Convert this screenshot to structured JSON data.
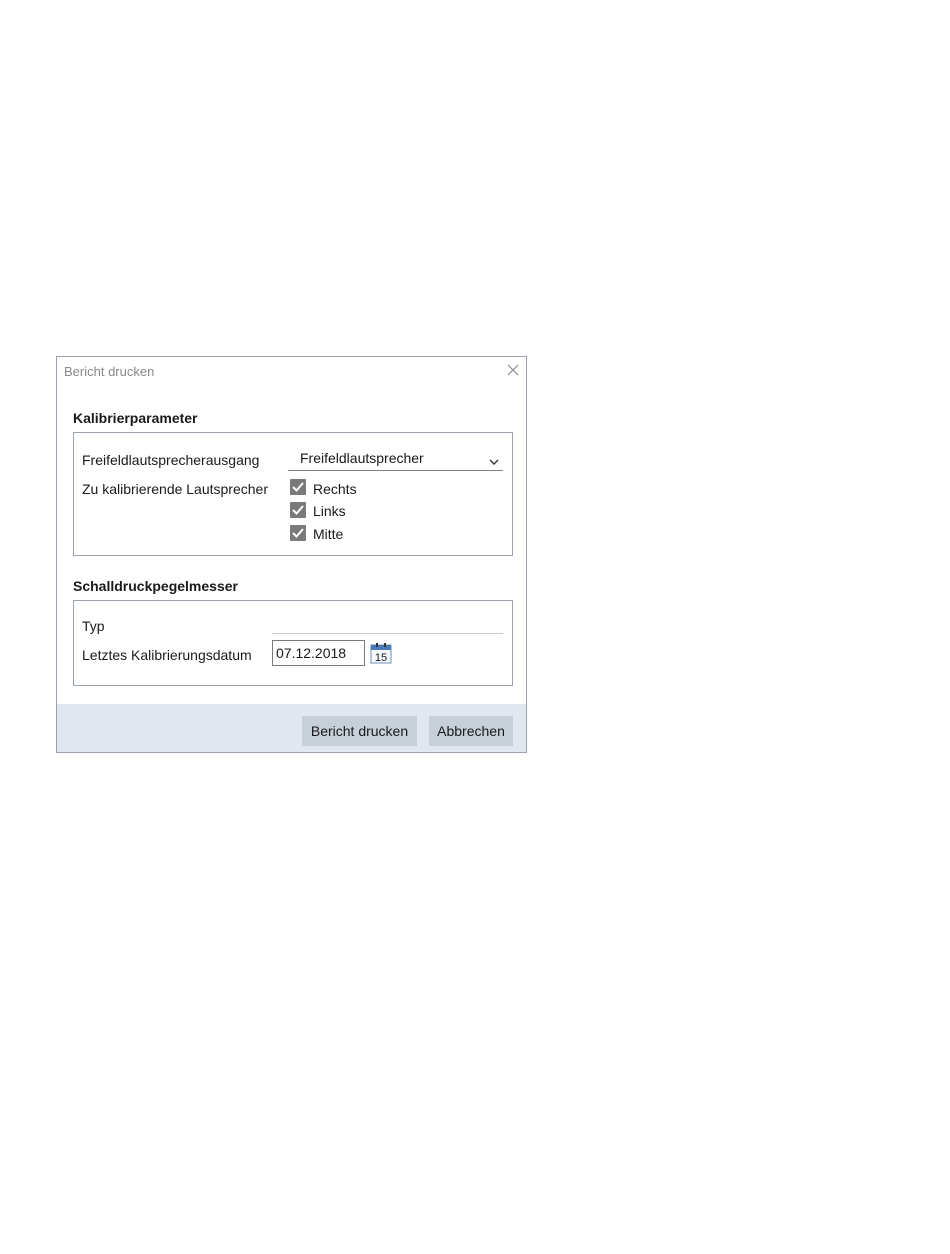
{
  "dialog": {
    "title": "Bericht drucken",
    "close_icon": "close-icon"
  },
  "calibration": {
    "section_title": "Kalibrierparameter",
    "output_label": "Freifeldlautsprecherausgang",
    "output_value": "Freifeldlautsprecher",
    "speakers_label": "Zu kalibrierende Lautsprecher",
    "speakers": [
      {
        "label": "Rechts",
        "checked": true
      },
      {
        "label": "Links",
        "checked": true
      },
      {
        "label": "Mitte",
        "checked": true
      }
    ]
  },
  "meter": {
    "section_title": "Schalldruckpegelmesser",
    "type_label": "Typ",
    "type_value": "",
    "date_label": "Letztes Kalibrierungsdatum",
    "date_value": "07.12.2018",
    "calendar_day": "15"
  },
  "footer": {
    "print_label": "Bericht drucken",
    "cancel_label": "Abbrechen"
  },
  "colors": {
    "footer_bg": "#e1e7ef",
    "button_bg": "#c7cfd9",
    "calendar_accent": "#4a7ab8"
  }
}
